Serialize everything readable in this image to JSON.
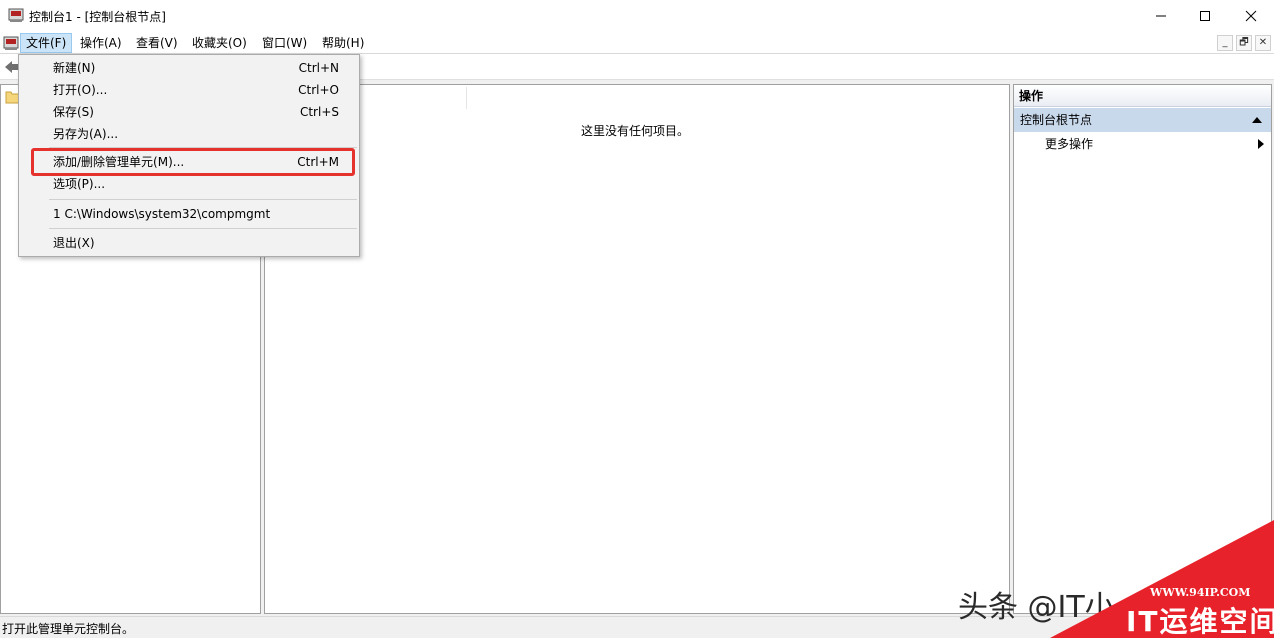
{
  "window": {
    "title": "控制台1 - [控制台根节点]",
    "minimize": "—",
    "maximize": "☐",
    "close": "✕"
  },
  "menubar": {
    "items": [
      "文件(F)",
      "操作(A)",
      "查看(V)",
      "收藏夹(O)",
      "窗口(W)",
      "帮助(H)"
    ],
    "mdi": {
      "minimize": "_",
      "restore": "🗗",
      "close": "✕"
    }
  },
  "file_menu": {
    "items": [
      {
        "label": "新建(N)",
        "shortcut": "Ctrl+N"
      },
      {
        "label": "打开(O)...",
        "shortcut": "Ctrl+O"
      },
      {
        "label": "保存(S)",
        "shortcut": "Ctrl+S"
      },
      {
        "label": "另存为(A)...",
        "shortcut": ""
      },
      {
        "label": "添加/删除管理单元(M)...",
        "shortcut": "Ctrl+M"
      },
      {
        "label": "选项(P)...",
        "shortcut": ""
      },
      {
        "label": "1 C:\\Windows\\system32\\compmgmt",
        "shortcut": ""
      },
      {
        "label": "退出(X)",
        "shortcut": ""
      }
    ]
  },
  "content": {
    "empty_message": "这里没有任何项目。"
  },
  "actions": {
    "header": "操作",
    "section": "控制台根节点",
    "more": "更多操作"
  },
  "status": {
    "text": "打开此管理单元控制台。"
  },
  "watermark": {
    "source": "头条 @IT小",
    "url": "WWW.94IP.COM",
    "name": "IT运维空间"
  },
  "colors": {
    "highlight": "#e5322d",
    "menu_active": "#cce4f7",
    "section_bg": "#c9d9ec"
  }
}
